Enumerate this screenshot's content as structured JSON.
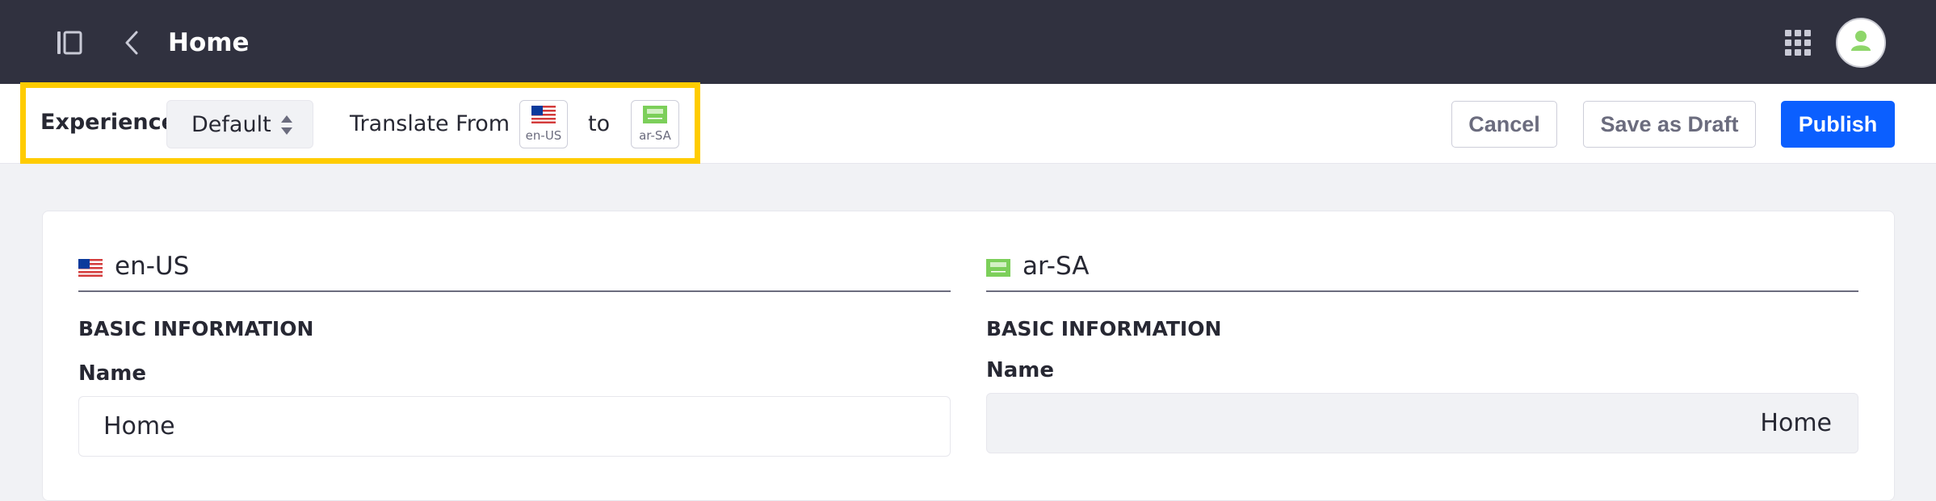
{
  "header": {
    "title": "Home",
    "icons": {
      "sidebar_toggle": "sidebar-toggle-icon",
      "back": "chevron-left-icon",
      "apps": "apps-grid-icon",
      "avatar": "user-avatar-icon"
    }
  },
  "toolbar": {
    "experience_label": "Experience",
    "experience_value": "Default",
    "translate_from_label": "Translate From",
    "from_locale": "en-US",
    "to_label": "to",
    "to_locale": "ar-SA",
    "cancel_label": "Cancel",
    "save_draft_label": "Save as Draft",
    "publish_label": "Publish"
  },
  "colors": {
    "header_bg": "#30313f",
    "primary": "#0b5fff",
    "highlight": "#ffcc00",
    "avatar_icon": "#8ed66a"
  },
  "source": {
    "locale": "en-US",
    "section_title": "BASIC INFORMATION",
    "name_label": "Name",
    "name_value": "Home"
  },
  "target": {
    "locale": "ar-SA",
    "section_title": "BASIC INFORMATION",
    "name_label": "Name",
    "name_value": "Home"
  }
}
